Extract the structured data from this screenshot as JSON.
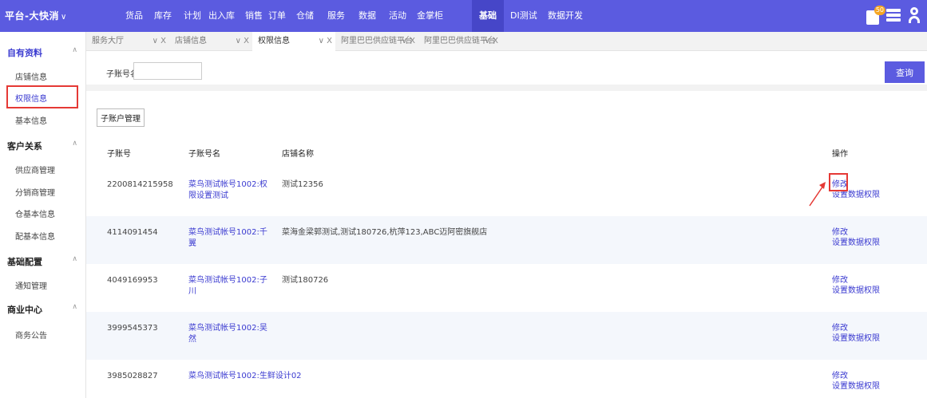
{
  "app": {
    "title": "平台-大快消",
    "title_chevron": "∨"
  },
  "topnav": {
    "items": [
      "货品",
      "库存",
      "计划",
      "出入库",
      "销售",
      "订单",
      "仓储",
      "服务",
      "数据",
      "活动",
      "金掌柜",
      "基础",
      "DI测试",
      "数据开发"
    ],
    "active": "基础"
  },
  "topicons": {
    "message_badge": "50",
    "icons": [
      "message-icon",
      "list-icon",
      "user-icon"
    ]
  },
  "sidebar": {
    "groups": [
      {
        "label": "自有资料",
        "chevron": "∧",
        "items": [
          "店铺信息",
          "权限信息",
          "基本信息"
        ]
      },
      {
        "label": "客户关系",
        "chevron": "∧",
        "items": [
          "供应商管理",
          "分销商管理",
          "仓基本信息",
          "配基本信息"
        ]
      },
      {
        "label": "基础配置",
        "chevron": "∧",
        "items": [
          "通知管理"
        ]
      },
      {
        "label": "商业中心",
        "chevron": "∧",
        "items": [
          "商务公告"
        ]
      }
    ],
    "active_item": "权限信息"
  },
  "tabs": [
    {
      "label": "服务大厅",
      "ctrl": "∨ X"
    },
    {
      "label": "店铺信息",
      "ctrl": "∨ X"
    },
    {
      "label": "权限信息",
      "ctrl": "∨ X"
    },
    {
      "label": "阿里巴巴供应链平台",
      "ctrl": "∨ X"
    },
    {
      "label": "阿里巴巴供应链平台",
      "ctrl": "∨ X"
    }
  ],
  "search": {
    "label": "子账号名",
    "value": "",
    "placeholder": "",
    "button": "查询"
  },
  "content": {
    "sub_account_button": "子账户管理",
    "columns": [
      "子账号",
      "子账号名",
      "店铺名称",
      "操作"
    ],
    "rows": [
      {
        "id": "2200814215958",
        "name": "菜鸟测试帐号1002:权限设置测试",
        "shop": "测试12356"
      },
      {
        "id": "4114091454",
        "name": "菜鸟测试帐号1002:千翼",
        "shop": "菜海金梁郭测试,测试180726,杭萍123,ABC迈阿密旗舰店"
      },
      {
        "id": "4049169953",
        "name": "菜鸟测试帐号1002:子川",
        "shop": "测试180726"
      },
      {
        "id": "3999545373",
        "name": "菜鸟测试帐号1002:吴然",
        "shop": ""
      },
      {
        "id": "3985028827",
        "name": "菜鸟测试帐号1002:生鲜设计02",
        "shop": ""
      }
    ],
    "op_edit": "修改",
    "op_perm": "设置数据权限"
  },
  "colors": {
    "accent": "#5b5be0",
    "link": "#3a3ad0",
    "highlight": "#e53935",
    "row_alt": "#f4f7fc"
  }
}
